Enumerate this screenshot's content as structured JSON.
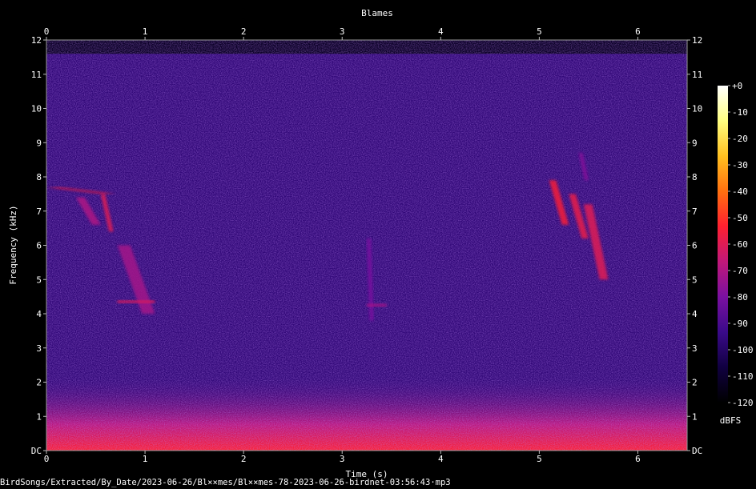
{
  "chart_data": {
    "type": "heatmap",
    "subtype": "spectrogram",
    "title": "Blames",
    "xlabel": "Time (s)",
    "ylabel": "Frequency (kHz)",
    "xlim": [
      0,
      6.5
    ],
    "ylim": [
      0,
      12
    ],
    "x_ticks": [
      "0",
      "1",
      "2",
      "3",
      "4",
      "5",
      "6"
    ],
    "y_ticks": [
      "DC",
      "1",
      "2",
      "3",
      "4",
      "5",
      "6",
      "7",
      "8",
      "9",
      "10",
      "11",
      "12"
    ],
    "colorbar": {
      "unit": "dBFS",
      "range": [
        -120,
        0
      ],
      "ticks": [
        "+0",
        "-10",
        "-20",
        "-30",
        "-40",
        "-50",
        "-60",
        "-70",
        "-80",
        "-90",
        "-100",
        "-110",
        "-120"
      ],
      "colors": [
        "#000000",
        "#100040",
        "#3a0a8a",
        "#7a10a0",
        "#c0187a",
        "#ff2030",
        "#ff7010",
        "#ffc020",
        "#ffff80",
        "#ffffff"
      ]
    },
    "noise_floor_dbfs": -95,
    "energy_ceiling_khz": 11.6,
    "low_band": {
      "from_khz": 0,
      "to_khz": 2.2,
      "level_dbfs": -62
    },
    "events": [
      {
        "t_start": 0.0,
        "t_end": 0.7,
        "f_start_khz": 7.7,
        "f_end_khz": 7.5,
        "level_dbfs": -55
      },
      {
        "t_start": 0.3,
        "t_end": 0.55,
        "f_start_khz": 7.4,
        "f_end_khz": 6.6,
        "level_dbfs": -70
      },
      {
        "t_start": 0.55,
        "t_end": 0.68,
        "f_start_khz": 7.5,
        "f_end_khz": 6.4,
        "level_dbfs": -60
      },
      {
        "t_start": 0.72,
        "t_end": 1.1,
        "f_start_khz": 6.0,
        "f_end_khz": 4.0,
        "level_dbfs": -72
      },
      {
        "t_start": 0.72,
        "t_end": 1.1,
        "f_start_khz": 4.35,
        "f_end_khz": 4.35,
        "level_dbfs": -62
      },
      {
        "t_start": 3.25,
        "t_end": 3.32,
        "f_start_khz": 6.2,
        "f_end_khz": 3.8,
        "level_dbfs": -80
      },
      {
        "t_start": 3.25,
        "t_end": 3.45,
        "f_start_khz": 4.25,
        "f_end_khz": 4.25,
        "level_dbfs": -72
      },
      {
        "t_start": 5.1,
        "t_end": 5.3,
        "f_start_khz": 7.9,
        "f_end_khz": 6.6,
        "level_dbfs": -55
      },
      {
        "t_start": 5.3,
        "t_end": 5.5,
        "f_start_khz": 7.5,
        "f_end_khz": 6.2,
        "level_dbfs": -58
      },
      {
        "t_start": 5.45,
        "t_end": 5.7,
        "f_start_khz": 7.2,
        "f_end_khz": 5.0,
        "level_dbfs": -60
      },
      {
        "t_start": 5.4,
        "t_end": 5.5,
        "f_start_khz": 8.7,
        "f_end_khz": 7.9,
        "level_dbfs": -78
      }
    ]
  },
  "footer": {
    "source_path": "BirdSongs/Extracted/By_Date/2023-06-26/Bl××mes/Bl××mes-78-2023-06-26-birdnet-03:56:43·mp3"
  }
}
